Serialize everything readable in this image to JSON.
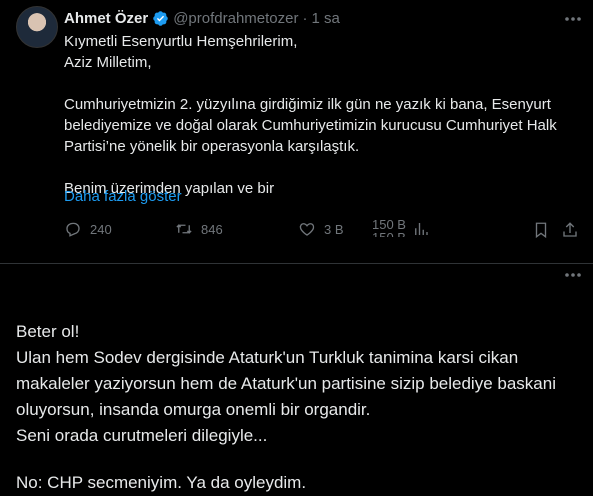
{
  "tweet": {
    "author_name": "Ahmet Özer",
    "handle": "@profdrahmetozer",
    "separator": "·",
    "time": "1 sa",
    "lines": [
      "Kıymetli Esenyurtlu Hemşehrilerim,",
      "Aziz Milletim,",
      "",
      "Cumhuriyetmizin 2. yüzyılına girdiğimiz ilk gün ne yazık ki bana, Esenyurt",
      "belediyemize ve doğal olarak Cumhuriyetimizin kurucusu Cumhuriyet Halk",
      "Partisi’ne yönelik bir operasyonla karşılaştık.",
      "",
      "Benim üzerimden yapılan ve bir"
    ],
    "show_more": "Daha fazla göster",
    "stats": {
      "replies": "240",
      "retweets": "846",
      "likes": "3 B",
      "views_a": "150 B",
      "views_b": "150 B"
    },
    "colors": {
      "link": "#1d9bf0",
      "verified": "#1d9bf0",
      "muted": "#71767b"
    }
  },
  "reply": {
    "lines": [
      "Beter ol!",
      "Ulan hem Sodev dergisinde Ataturk'un Turkluk tanimina karsi cikan",
      "makaleler yaziyorsun hem de Ataturk'un partisine sizip belediye baskani",
      "oluyorsun, insanda omurga onemli bir organdir.",
      "Seni orada curutmeleri dilegiyle...",
      "",
      "No: CHP secmeniyim. Ya da oyleydim."
    ]
  }
}
